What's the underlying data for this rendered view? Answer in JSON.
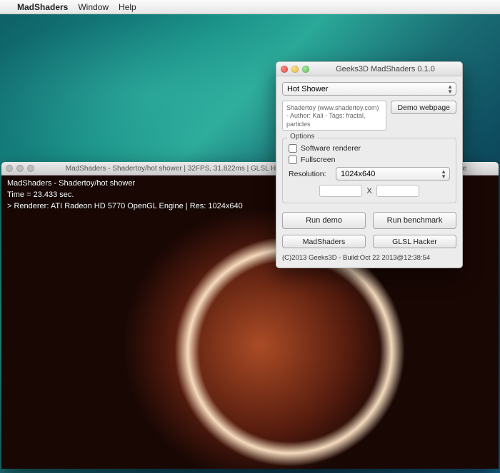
{
  "menubar": {
    "apple": "",
    "app_name": "MadShaders",
    "items": [
      "Window",
      "Help"
    ]
  },
  "render_window": {
    "title": "MadShaders - Shadertoy/hot shower | 32FPS, 31.822ms | GLSL Hacker BETA v0.6.3.0 | ATI Radeon HD 5770 OpenGL Engine",
    "overlay": {
      "line1": "MadShaders - Shadertoy/hot shower",
      "line2": "Time = 23.433 sec.",
      "line3": "> Renderer: ATI Radeon HD 5770 OpenGL Engine | Res: 1024x640"
    }
  },
  "settings_window": {
    "title": "Geeks3D MadShaders 0.1.0",
    "demo_select": "Hot Shower",
    "info_text": "Shadertoy (www.shadertoy.com) - Author: Kali - Tags: fractal, particles",
    "demo_webpage_btn": "Demo webpage",
    "options": {
      "label": "Options",
      "software_renderer": "Software renderer",
      "fullscreen": "Fullscreen",
      "resolution_label": "Resolution:",
      "resolution_value": "1024x640",
      "dim_x": "",
      "dim_sep": "X",
      "dim_y": ""
    },
    "run_demo_btn": "Run demo",
    "run_bench_btn": "Run benchmark",
    "madshaders_btn": "MadShaders",
    "glsl_hacker_btn": "GLSL Hacker",
    "copyright": "(C)2013 Geeks3D - Build:Oct 22 2013@12:38:54"
  }
}
